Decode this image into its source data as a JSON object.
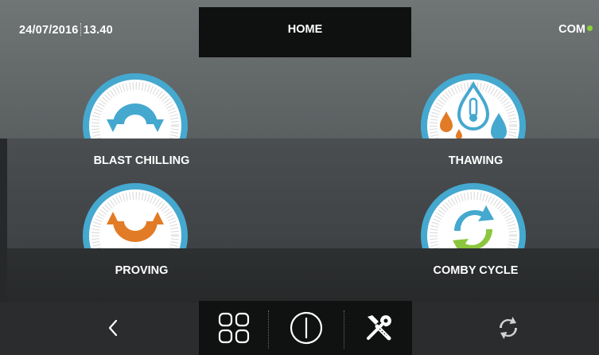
{
  "header": {
    "date": "24/07/2016",
    "time": "13.40",
    "title": "HOME",
    "status_label": "COM",
    "status_color": "#8cd13b"
  },
  "modes": [
    {
      "label": "BLAST CHILLING",
      "icon": "blast-chilling-icon",
      "accent": "#45a8cf"
    },
    {
      "label": "THAWING",
      "icon": "thawing-icon",
      "accent": "#45a8cf"
    },
    {
      "label": "PROVING",
      "icon": "proving-icon",
      "accent": "#e27b25"
    },
    {
      "label": "COMBY CYCLE",
      "icon": "comby-cycle-icon",
      "accent": "#8cc63e"
    }
  ],
  "bottom_nav": {
    "back": "back-arrow-icon",
    "menu": "grid-menu-icon",
    "power": "power-icon",
    "tools": "tools-icon",
    "refresh": "refresh-icon"
  }
}
